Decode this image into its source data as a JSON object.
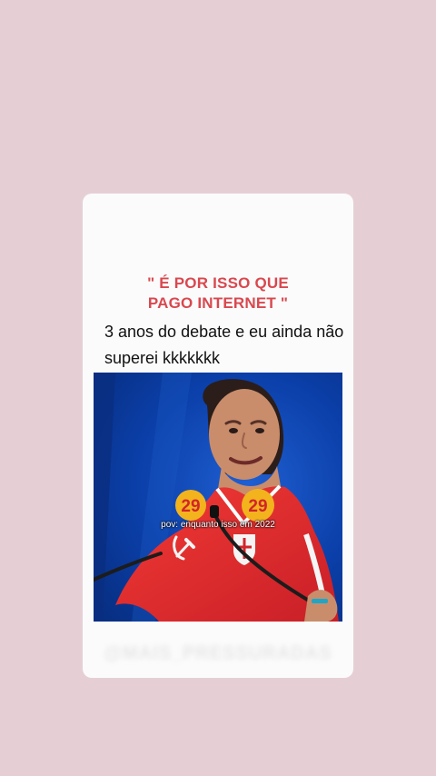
{
  "story": {
    "quote_line_1": "\" É POR ISSO QUE",
    "quote_line_2": "PAGO INTERNET \"",
    "caption": "3 anos do debate e eu ainda não superei kkkkkkk",
    "video_overlay_text": "pov: enquanto isso em 2022",
    "watermark_text": "@MAIS_PRESSURADAS"
  },
  "colors": {
    "background": "#e5cfd5",
    "card": "#fbfbfb",
    "quote": "#d9484f",
    "video_background": "#0b38a3",
    "shirt": "#e12a2e",
    "badge": "#f2b31d"
  },
  "shirt_badges": [
    "29",
    "29"
  ]
}
